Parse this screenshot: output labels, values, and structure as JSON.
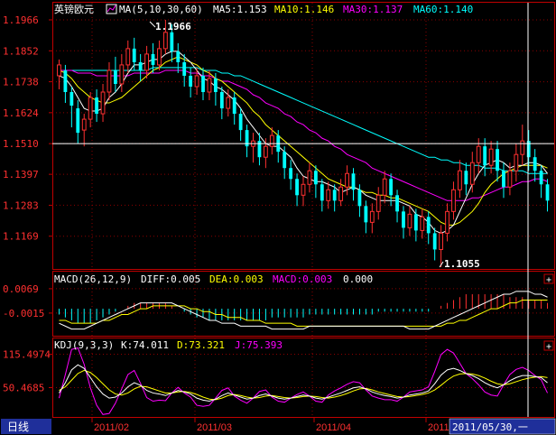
{
  "colors": {
    "background": "#000000",
    "frame": "#c00000",
    "grid": "#8b0000",
    "up": "#ff3030",
    "down": "#00ffff",
    "ma5": "#ffffff",
    "ma10": "#ffff00",
    "ma30": "#ff00ff",
    "ma60": "#00ffff",
    "macd_diff": "#ffffff",
    "macd_dea": "#ffff00",
    "kdj_k": "#ffffff",
    "kdj_d": "#ffff00",
    "kdj_j": "#ff00ff",
    "hline": "#ffffff"
  },
  "header": {
    "symbol": "英镑欧元",
    "ma_icon": "chart-icon",
    "ma_params": "MA(5,10,30,60)",
    "ma5": "MA5:1.153",
    "ma10": "MA10:1.146",
    "ma30": "MA30:1.137",
    "ma60": "MA60:1.140"
  },
  "macd_header": {
    "params": "MACD(26,12,9)",
    "diff": "DIFF:0.005",
    "dea": "DEA:0.003",
    "macd": "MACD:0.003",
    "zero": "0.000"
  },
  "kdj_header": {
    "params": "KDJ(9,3,3)",
    "k": "K:74.011",
    "d": "D:73.321",
    "j": "J:75.393"
  },
  "bottom": {
    "period": "日线",
    "cursor_date": "2011/05/30,一",
    "x_labels": [
      "2011/02",
      "2011/03",
      "2011/04",
      "2011"
    ]
  },
  "price_axis": [
    "1.1966",
    "1.1852",
    "1.1738",
    "1.1624",
    "1.1510",
    "1.1397",
    "1.1283",
    "1.1169"
  ],
  "macd_axis": [
    "0.0069",
    "-0.0015"
  ],
  "kdj_axis": [
    "115.4974",
    "50.4685"
  ],
  "annotations": {
    "high": "1.1966",
    "low": "1.1055"
  },
  "chart_data": {
    "type": "candlestick",
    "price_range": [
      1.1055,
      1.1966
    ],
    "current_price_line": 1.151,
    "candles": [
      [
        1.176,
        1.18,
        1.171,
        1.182
      ],
      [
        1.178,
        1.17,
        1.166,
        1.18
      ],
      [
        1.17,
        1.165,
        1.157,
        1.172
      ],
      [
        1.164,
        1.155,
        1.151,
        1.167
      ],
      [
        1.156,
        1.16,
        1.15,
        1.162
      ],
      [
        1.16,
        1.168,
        1.157,
        1.17
      ],
      [
        1.168,
        1.162,
        1.159,
        1.171
      ],
      [
        1.162,
        1.17,
        1.159,
        1.173
      ],
      [
        1.17,
        1.178,
        1.167,
        1.181
      ],
      [
        1.178,
        1.173,
        1.17,
        1.183
      ],
      [
        1.173,
        1.18,
        1.17,
        1.184
      ],
      [
        1.18,
        1.186,
        1.177,
        1.189
      ],
      [
        1.186,
        1.181,
        1.178,
        1.19
      ],
      [
        1.181,
        1.178,
        1.174,
        1.184
      ],
      [
        1.178,
        1.184,
        1.175,
        1.187
      ],
      [
        1.184,
        1.18,
        1.177,
        1.188
      ],
      [
        1.18,
        1.186,
        1.178,
        1.189
      ],
      [
        1.186,
        1.192,
        1.184,
        1.1966
      ],
      [
        1.192,
        1.185,
        1.181,
        1.195
      ],
      [
        1.185,
        1.181,
        1.177,
        1.188
      ],
      [
        1.181,
        1.176,
        1.172,
        1.184
      ],
      [
        1.176,
        1.172,
        1.168,
        1.179
      ],
      [
        1.172,
        1.176,
        1.169,
        1.179
      ],
      [
        1.176,
        1.17,
        1.167,
        1.179
      ],
      [
        1.17,
        1.175,
        1.167,
        1.178
      ],
      [
        1.175,
        1.17,
        1.165,
        1.177
      ],
      [
        1.17,
        1.164,
        1.16,
        1.172
      ],
      [
        1.164,
        1.168,
        1.161,
        1.171
      ],
      [
        1.168,
        1.162,
        1.158,
        1.17
      ],
      [
        1.162,
        1.156,
        1.152,
        1.164
      ],
      [
        1.156,
        1.15,
        1.146,
        1.158
      ],
      [
        1.15,
        1.152,
        1.144,
        1.155
      ],
      [
        1.152,
        1.146,
        1.143,
        1.155
      ],
      [
        1.146,
        1.15,
        1.142,
        1.153
      ],
      [
        1.15,
        1.154,
        1.147,
        1.157
      ],
      [
        1.154,
        1.148,
        1.144,
        1.156
      ],
      [
        1.148,
        1.142,
        1.138,
        1.15
      ],
      [
        1.142,
        1.138,
        1.134,
        1.145
      ],
      [
        1.138,
        1.132,
        1.128,
        1.14
      ],
      [
        1.132,
        1.136,
        1.128,
        1.139
      ],
      [
        1.136,
        1.141,
        1.133,
        1.144
      ],
      [
        1.141,
        1.136,
        1.131,
        1.143
      ],
      [
        1.136,
        1.13,
        1.126,
        1.138
      ],
      [
        1.13,
        1.134,
        1.127,
        1.137
      ],
      [
        1.134,
        1.13,
        1.126,
        1.136
      ],
      [
        1.13,
        1.135,
        1.128,
        1.138
      ],
      [
        1.135,
        1.14,
        1.132,
        1.143
      ],
      [
        1.14,
        1.134,
        1.13,
        1.142
      ],
      [
        1.134,
        1.128,
        1.124,
        1.136
      ],
      [
        1.128,
        1.122,
        1.118,
        1.13
      ],
      [
        1.122,
        1.126,
        1.118,
        1.129
      ],
      [
        1.126,
        1.132,
        1.123,
        1.135
      ],
      [
        1.132,
        1.138,
        1.129,
        1.141
      ],
      [
        1.138,
        1.132,
        1.128,
        1.14
      ],
      [
        1.132,
        1.126,
        1.122,
        1.134
      ],
      [
        1.126,
        1.12,
        1.116,
        1.128
      ],
      [
        1.12,
        1.125,
        1.117,
        1.128
      ],
      [
        1.125,
        1.119,
        1.115,
        1.127
      ],
      [
        1.119,
        1.124,
        1.116,
        1.127
      ],
      [
        1.124,
        1.118,
        1.114,
        1.126
      ],
      [
        1.118,
        1.112,
        1.108,
        1.12
      ],
      [
        1.112,
        1.118,
        1.1055,
        1.121
      ],
      [
        1.118,
        1.126,
        1.115,
        1.129
      ],
      [
        1.126,
        1.134,
        1.123,
        1.137
      ],
      [
        1.134,
        1.141,
        1.131,
        1.145
      ],
      [
        1.141,
        1.136,
        1.132,
        1.144
      ],
      [
        1.136,
        1.144,
        1.133,
        1.148
      ],
      [
        1.144,
        1.15,
        1.14,
        1.153
      ],
      [
        1.15,
        1.143,
        1.139,
        1.153
      ],
      [
        1.143,
        1.149,
        1.14,
        1.152
      ],
      [
        1.149,
        1.141,
        1.137,
        1.152
      ],
      [
        1.141,
        1.135,
        1.131,
        1.144
      ],
      [
        1.135,
        1.141,
        1.132,
        1.144
      ],
      [
        1.141,
        1.147,
        1.137,
        1.151
      ],
      [
        1.147,
        1.152,
        1.143,
        1.158
      ],
      [
        1.152,
        1.146,
        1.141,
        1.156
      ],
      [
        1.146,
        1.141,
        1.137,
        1.149
      ],
      [
        1.141,
        1.136,
        1.131,
        1.143
      ],
      [
        1.136,
        1.13,
        1.126,
        1.138
      ]
    ],
    "ma5": [
      1.176,
      1.175,
      1.172,
      1.168,
      1.164,
      1.163,
      1.163,
      1.164,
      1.168,
      1.17,
      1.173,
      1.177,
      1.18,
      1.18,
      1.181,
      1.182,
      1.182,
      1.184,
      1.185,
      1.185,
      1.183,
      1.181,
      1.178,
      1.175,
      1.174,
      1.172,
      1.171,
      1.169,
      1.167,
      1.164,
      1.16,
      1.157,
      1.154,
      1.151,
      1.15,
      1.15,
      1.148,
      1.146,
      1.142,
      1.139,
      1.138,
      1.137,
      1.137,
      1.136,
      1.135,
      1.133,
      1.134,
      1.135,
      1.134,
      1.132,
      1.131,
      1.13,
      1.13,
      1.13,
      1.13,
      1.129,
      1.128,
      1.125,
      1.124,
      1.122,
      1.119,
      1.118,
      1.119,
      1.121,
      1.126,
      1.131,
      1.136,
      1.14,
      1.143,
      1.144,
      1.145,
      1.144,
      1.142,
      1.143,
      1.143,
      1.144,
      1.144,
      1.143,
      1.14
    ],
    "ma10": [
      1.178,
      1.177,
      1.175,
      1.172,
      1.17,
      1.168,
      1.167,
      1.166,
      1.166,
      1.167,
      1.168,
      1.17,
      1.172,
      1.174,
      1.176,
      1.178,
      1.179,
      1.181,
      1.182,
      1.183,
      1.182,
      1.181,
      1.18,
      1.178,
      1.177,
      1.175,
      1.174,
      1.172,
      1.17,
      1.168,
      1.166,
      1.163,
      1.161,
      1.158,
      1.156,
      1.154,
      1.152,
      1.15,
      1.148,
      1.146,
      1.144,
      1.142,
      1.14,
      1.138,
      1.137,
      1.136,
      1.135,
      1.135,
      1.134,
      1.133,
      1.133,
      1.132,
      1.132,
      1.131,
      1.131,
      1.13,
      1.129,
      1.128,
      1.127,
      1.126,
      1.124,
      1.122,
      1.121,
      1.121,
      1.122,
      1.124,
      1.126,
      1.129,
      1.133,
      1.136,
      1.138,
      1.14,
      1.141,
      1.142,
      1.143,
      1.143,
      1.143,
      1.143,
      1.142
    ],
    "ma30": [
      1.178,
      1.178,
      1.178,
      1.177,
      1.177,
      1.177,
      1.176,
      1.176,
      1.176,
      1.176,
      1.176,
      1.176,
      1.177,
      1.177,
      1.177,
      1.177,
      1.177,
      1.178,
      1.178,
      1.178,
      1.178,
      1.177,
      1.177,
      1.176,
      1.176,
      1.175,
      1.174,
      1.174,
      1.173,
      1.172,
      1.171,
      1.169,
      1.168,
      1.166,
      1.165,
      1.164,
      1.162,
      1.161,
      1.159,
      1.158,
      1.156,
      1.155,
      1.153,
      1.152,
      1.15,
      1.149,
      1.147,
      1.146,
      1.145,
      1.144,
      1.142,
      1.141,
      1.14,
      1.139,
      1.138,
      1.137,
      1.136,
      1.135,
      1.134,
      1.133,
      1.132,
      1.131,
      1.13,
      1.13,
      1.13,
      1.13,
      1.131,
      1.131,
      1.132,
      1.133,
      1.134,
      1.135,
      1.135,
      1.136,
      1.137,
      1.137,
      1.138,
      1.138,
      1.137
    ],
    "ma60": [
      1.178,
      1.178,
      1.178,
      1.178,
      1.178,
      1.178,
      1.178,
      1.178,
      1.178,
      1.178,
      1.178,
      1.178,
      1.178,
      1.178,
      1.178,
      1.179,
      1.179,
      1.179,
      1.179,
      1.179,
      1.179,
      1.179,
      1.179,
      1.178,
      1.178,
      1.178,
      1.177,
      1.177,
      1.176,
      1.176,
      1.175,
      1.174,
      1.173,
      1.172,
      1.171,
      1.17,
      1.169,
      1.168,
      1.167,
      1.166,
      1.165,
      1.164,
      1.163,
      1.162,
      1.161,
      1.16,
      1.159,
      1.158,
      1.157,
      1.156,
      1.155,
      1.154,
      1.153,
      1.152,
      1.151,
      1.15,
      1.149,
      1.148,
      1.147,
      1.146,
      1.146,
      1.145,
      1.145,
      1.144,
      1.144,
      1.143,
      1.143,
      1.143,
      1.142,
      1.142,
      1.142,
      1.141,
      1.141,
      1.141,
      1.141,
      1.14,
      1.14,
      1.14,
      1.14
    ],
    "macd_range": [
      -0.009,
      0.0075
    ],
    "macd_hist": [
      -0.002,
      -0.003,
      -0.004,
      -0.005,
      -0.005,
      -0.005,
      -0.004,
      -0.003,
      -0.002,
      -0.001,
      0.0,
      0.001,
      0.002,
      0.002,
      0.002,
      0.002,
      0.002,
      0.002,
      0.001,
      0.0,
      -0.001,
      -0.002,
      -0.003,
      -0.003,
      -0.004,
      -0.004,
      -0.004,
      -0.004,
      -0.004,
      -0.004,
      -0.004,
      -0.004,
      -0.004,
      -0.004,
      -0.003,
      -0.003,
      -0.003,
      -0.003,
      -0.003,
      -0.003,
      -0.002,
      -0.002,
      -0.002,
      -0.002,
      -0.002,
      -0.002,
      -0.002,
      -0.002,
      -0.002,
      -0.002,
      -0.002,
      -0.001,
      -0.001,
      -0.001,
      -0.001,
      -0.001,
      -0.001,
      -0.001,
      -0.001,
      -0.001,
      0.0,
      0.001,
      0.002,
      0.003,
      0.004,
      0.005,
      0.005,
      0.005,
      0.005,
      0.005,
      0.005,
      0.005,
      0.004,
      0.004,
      0.004,
      0.003,
      0.003,
      0.003,
      0.002
    ],
    "macd_diff": [
      -0.005,
      -0.006,
      -0.007,
      -0.007,
      -0.007,
      -0.006,
      -0.005,
      -0.004,
      -0.003,
      -0.002,
      -0.001,
      0.0,
      0.001,
      0.002,
      0.002,
      0.002,
      0.002,
      0.002,
      0.002,
      0.001,
      0.0,
      -0.001,
      -0.002,
      -0.003,
      -0.004,
      -0.004,
      -0.005,
      -0.005,
      -0.005,
      -0.006,
      -0.006,
      -0.006,
      -0.006,
      -0.006,
      -0.007,
      -0.007,
      -0.007,
      -0.007,
      -0.007,
      -0.007,
      -0.006,
      -0.006,
      -0.006,
      -0.006,
      -0.006,
      -0.006,
      -0.006,
      -0.006,
      -0.006,
      -0.006,
      -0.006,
      -0.006,
      -0.006,
      -0.006,
      -0.006,
      -0.006,
      -0.007,
      -0.007,
      -0.007,
      -0.007,
      -0.006,
      -0.005,
      -0.004,
      -0.003,
      -0.002,
      -0.001,
      0.0,
      0.001,
      0.002,
      0.003,
      0.004,
      0.005,
      0.005,
      0.006,
      0.006,
      0.006,
      0.005,
      0.005,
      0.004
    ],
    "macd_dea": [
      -0.004,
      -0.004,
      -0.005,
      -0.005,
      -0.005,
      -0.005,
      -0.005,
      -0.004,
      -0.004,
      -0.003,
      -0.002,
      -0.002,
      -0.001,
      0.0,
      0.0,
      0.001,
      0.001,
      0.001,
      0.001,
      0.001,
      0.001,
      0.0,
      0.0,
      -0.001,
      -0.001,
      -0.002,
      -0.002,
      -0.003,
      -0.003,
      -0.003,
      -0.004,
      -0.004,
      -0.004,
      -0.005,
      -0.005,
      -0.005,
      -0.005,
      -0.005,
      -0.006,
      -0.006,
      -0.006,
      -0.006,
      -0.006,
      -0.006,
      -0.006,
      -0.006,
      -0.006,
      -0.006,
      -0.006,
      -0.006,
      -0.006,
      -0.006,
      -0.006,
      -0.006,
      -0.006,
      -0.006,
      -0.006,
      -0.006,
      -0.006,
      -0.006,
      -0.006,
      -0.006,
      -0.005,
      -0.005,
      -0.004,
      -0.004,
      -0.003,
      -0.002,
      -0.001,
      0.0,
      0.0,
      0.001,
      0.002,
      0.002,
      0.003,
      0.003,
      0.003,
      0.003,
      0.003
    ],
    "kdj_range": [
      -5,
      120
    ],
    "kdj_k": [
      40,
      60,
      85,
      95,
      88,
      70,
      52,
      38,
      30,
      32,
      40,
      52,
      60,
      55,
      45,
      40,
      38,
      35,
      40,
      45,
      42,
      38,
      30,
      26,
      24,
      28,
      35,
      40,
      36,
      32,
      28,
      30,
      35,
      38,
      34,
      30,
      28,
      30,
      33,
      36,
      34,
      30,
      28,
      32,
      36,
      40,
      45,
      50,
      52,
      48,
      42,
      38,
      35,
      33,
      30,
      32,
      36,
      38,
      40,
      44,
      58,
      75,
      85,
      88,
      84,
      78,
      74,
      68,
      60,
      54,
      50,
      56,
      64,
      70,
      74,
      74,
      72,
      70,
      60
    ],
    "kdj_d": [
      45,
      52,
      65,
      78,
      84,
      80,
      70,
      58,
      46,
      38,
      36,
      40,
      48,
      53,
      52,
      48,
      44,
      40,
      40,
      42,
      43,
      41,
      37,
      32,
      28,
      27,
      30,
      35,
      37,
      35,
      32,
      30,
      31,
      34,
      35,
      33,
      31,
      30,
      31,
      33,
      34,
      33,
      31,
      30,
      32,
      35,
      39,
      44,
      48,
      49,
      46,
      42,
      39,
      36,
      33,
      32,
      33,
      35,
      37,
      40,
      46,
      55,
      65,
      73,
      77,
      78,
      77,
      74,
      69,
      63,
      58,
      56,
      58,
      62,
      66,
      69,
      71,
      72,
      70
    ],
    "kdj_j": [
      30,
      76,
      125,
      128,
      96,
      50,
      16,
      -2,
      0,
      20,
      48,
      76,
      84,
      59,
      31,
      24,
      26,
      25,
      40,
      51,
      40,
      32,
      16,
      14,
      16,
      30,
      45,
      50,
      34,
      26,
      20,
      30,
      43,
      46,
      32,
      24,
      22,
      30,
      37,
      42,
      34,
      24,
      22,
      36,
      44,
      50,
      57,
      62,
      60,
      46,
      34,
      30,
      27,
      27,
      24,
      32,
      42,
      44,
      46,
      52,
      82,
      115,
      125,
      118,
      98,
      78,
      68,
      56,
      42,
      36,
      34,
      56,
      76,
      86,
      90,
      84,
      74,
      66,
      40
    ]
  }
}
